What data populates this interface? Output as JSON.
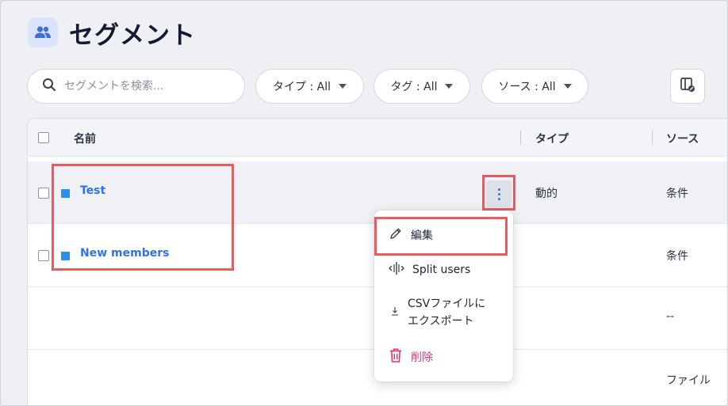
{
  "header": {
    "title": "セグメント",
    "icon": "users-icon"
  },
  "filters": {
    "search_placeholder": "セグメントを検索...",
    "type_filter": "タイプ : All",
    "tag_filter": "タグ : All",
    "source_filter": "ソース : All"
  },
  "table": {
    "headers": {
      "name": "名前",
      "type": "タイプ",
      "source": "ソース"
    },
    "rows": [
      {
        "name": "Test",
        "type": "動的",
        "source": "条件"
      },
      {
        "name": "New members",
        "type": "",
        "source": "条件"
      },
      {
        "name": "",
        "type": "",
        "source": "--"
      },
      {
        "name": "",
        "type": "",
        "source": "ファイル"
      }
    ]
  },
  "context_menu": {
    "edit": "編集",
    "split": "Split users",
    "export_line1": "CSVファイルに",
    "export_line2": "エクスポート",
    "delete": "削除"
  },
  "colors": {
    "accent": "#2f73e8",
    "highlight": "#e85c61",
    "danger": "#e0386e",
    "segment_swatch": "#2f8df2"
  }
}
